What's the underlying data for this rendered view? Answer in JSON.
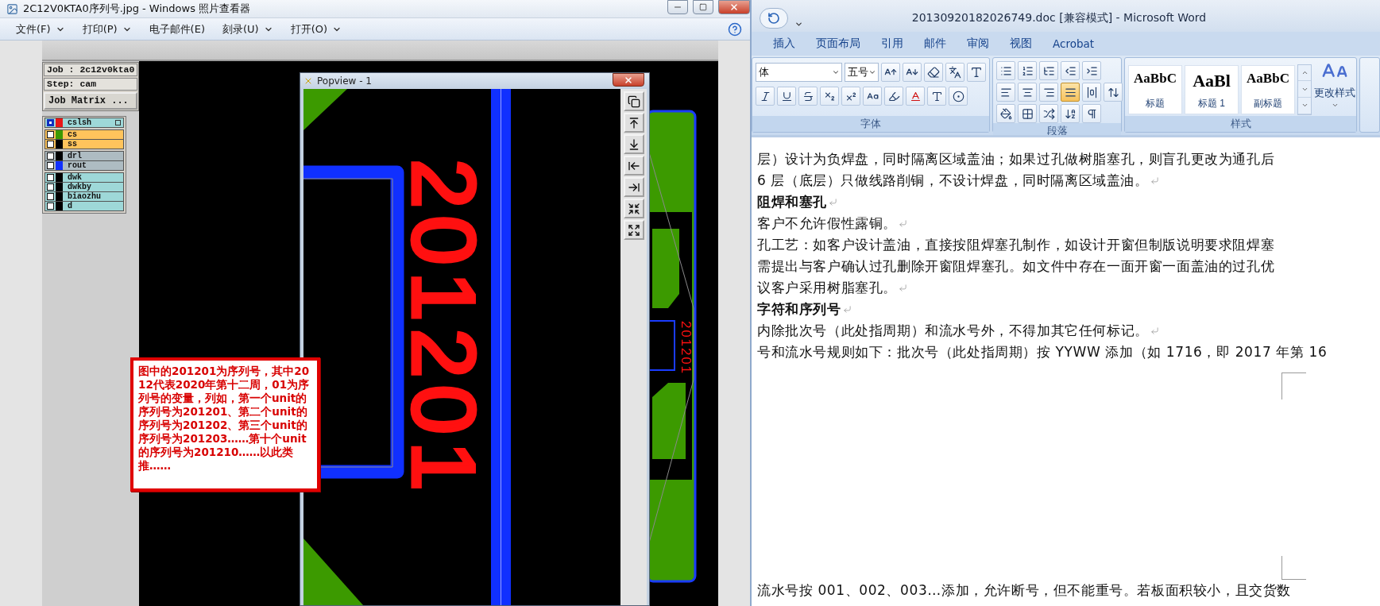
{
  "photo_viewer": {
    "title": "2C12V0KTA0序列号.jpg - Windows 照片查看器",
    "menu": [
      {
        "label": "文件(F)",
        "dropdown": true
      },
      {
        "label": "打印(P)",
        "dropdown": true
      },
      {
        "label": "电子邮件(E)",
        "dropdown": false
      },
      {
        "label": "刻录(U)",
        "dropdown": true
      },
      {
        "label": "打开(O)",
        "dropdown": true
      }
    ],
    "cam": {
      "job": "Job : 2c12v0kta0",
      "step": "Step: cam",
      "job_matrix_button": "Job Matrix ...",
      "layer_groups": [
        {
          "kind": "board",
          "layers": [
            {
              "name": "cslsh",
              "color": "#e81818",
              "selected": true
            }
          ]
        },
        {
          "kind": "silk",
          "layers": [
            {
              "name": "cs",
              "color": "#3c9a00",
              "selected": false
            },
            {
              "name": "ss",
              "color": "#000000",
              "selected": false
            }
          ]
        },
        {
          "kind": "drill",
          "layers": [
            {
              "name": "drl",
              "color": "#000000",
              "selected": false
            },
            {
              "name": "rout",
              "color": "#1030ff",
              "selected": false
            }
          ]
        },
        {
          "kind": "document",
          "layers": [
            {
              "name": "dwk",
              "color": "#000000",
              "selected": false
            },
            {
              "name": "dwkby",
              "color": "#000000",
              "selected": false
            },
            {
              "name": "biaozhu",
              "color": "#000000",
              "selected": false
            },
            {
              "name": "d",
              "color": "#000000",
              "selected": false
            }
          ]
        }
      ],
      "popview": {
        "title": "Popview - 1",
        "marking": "201201"
      },
      "board_marking": "201201",
      "note": "图中的201201为序列号，其中2012代表2020年第十二周，01为序列号的变量，列如，第一个unit的序列号为201201、第二个unit的序列号为201202、第三个unit的序列号为201203……第十个unit的序列号为201210……以此类推……"
    }
  },
  "word": {
    "title": "20130920182026749.doc [兼容模式] - Microsoft Word",
    "tabs": [
      "插入",
      "页面布局",
      "引用",
      "邮件",
      "审阅",
      "视图",
      "Acrobat"
    ],
    "ribbon": {
      "font_name": "体",
      "font_size": "五号",
      "font_group": "字体",
      "paragraph_group": "段落",
      "styles_group": "样式",
      "alignment": [
        {
          "selected": false
        },
        {
          "selected": false
        },
        {
          "selected": false
        },
        {
          "selected": true
        },
        {
          "selected": false
        }
      ],
      "styles": [
        {
          "sample": "AaBbC",
          "label": "标题"
        },
        {
          "sample": "AaBl",
          "label": "标题 1"
        },
        {
          "sample": "AaBbC",
          "label": "副标题"
        }
      ],
      "change_styles": "更改样式"
    },
    "document": {
      "lines": [
        {
          "text": "层）设计为负焊盘，同时隔离区域盖油；如果过孔做树脂塞孔，则盲孔更改为通孔后",
          "bold": false,
          "paragraph_end": false
        },
        {
          "text": "6 层（底层）只做线路削铜，不设计焊盘，同时隔离区域盖油。",
          "bold": false,
          "paragraph_end": true
        },
        {
          "text": "阻焊和塞孔",
          "bold": true,
          "paragraph_end": true
        },
        {
          "text": "客户不允许假性露铜。",
          "bold": false,
          "paragraph_end": true
        },
        {
          "text": "孔工艺：如客户设计盖油，直接按阻焊塞孔制作，如设计开窗但制版说明要求阻焊塞",
          "bold": false,
          "paragraph_end": false
        },
        {
          "text": "需提出与客户确认过孔删除开窗阻焊塞孔。如文件中存在一面开窗一面盖油的过孔优",
          "bold": false,
          "paragraph_end": false
        },
        {
          "text": "议客户采用树脂塞孔。",
          "bold": false,
          "paragraph_end": true
        },
        {
          "text": "字符和序列号",
          "bold": true,
          "paragraph_end": true
        },
        {
          "text": "内除批次号（此处指周期）和流水号外，不得加其它任何标记。",
          "bold": false,
          "paragraph_end": true
        },
        {
          "text": "号和流水号规则如下：批次号（此处指周期）按 YYWW 添加（如 1716，即 2017 年第 16",
          "bold": false,
          "paragraph_end": false
        }
      ],
      "next_page_lines": [
        {
          "text": "流水号按 001、002、003…添加，允许断号，但不能重号。若板面积较小，且交货数",
          "bold": false,
          "paragraph_end": false
        }
      ]
    }
  }
}
